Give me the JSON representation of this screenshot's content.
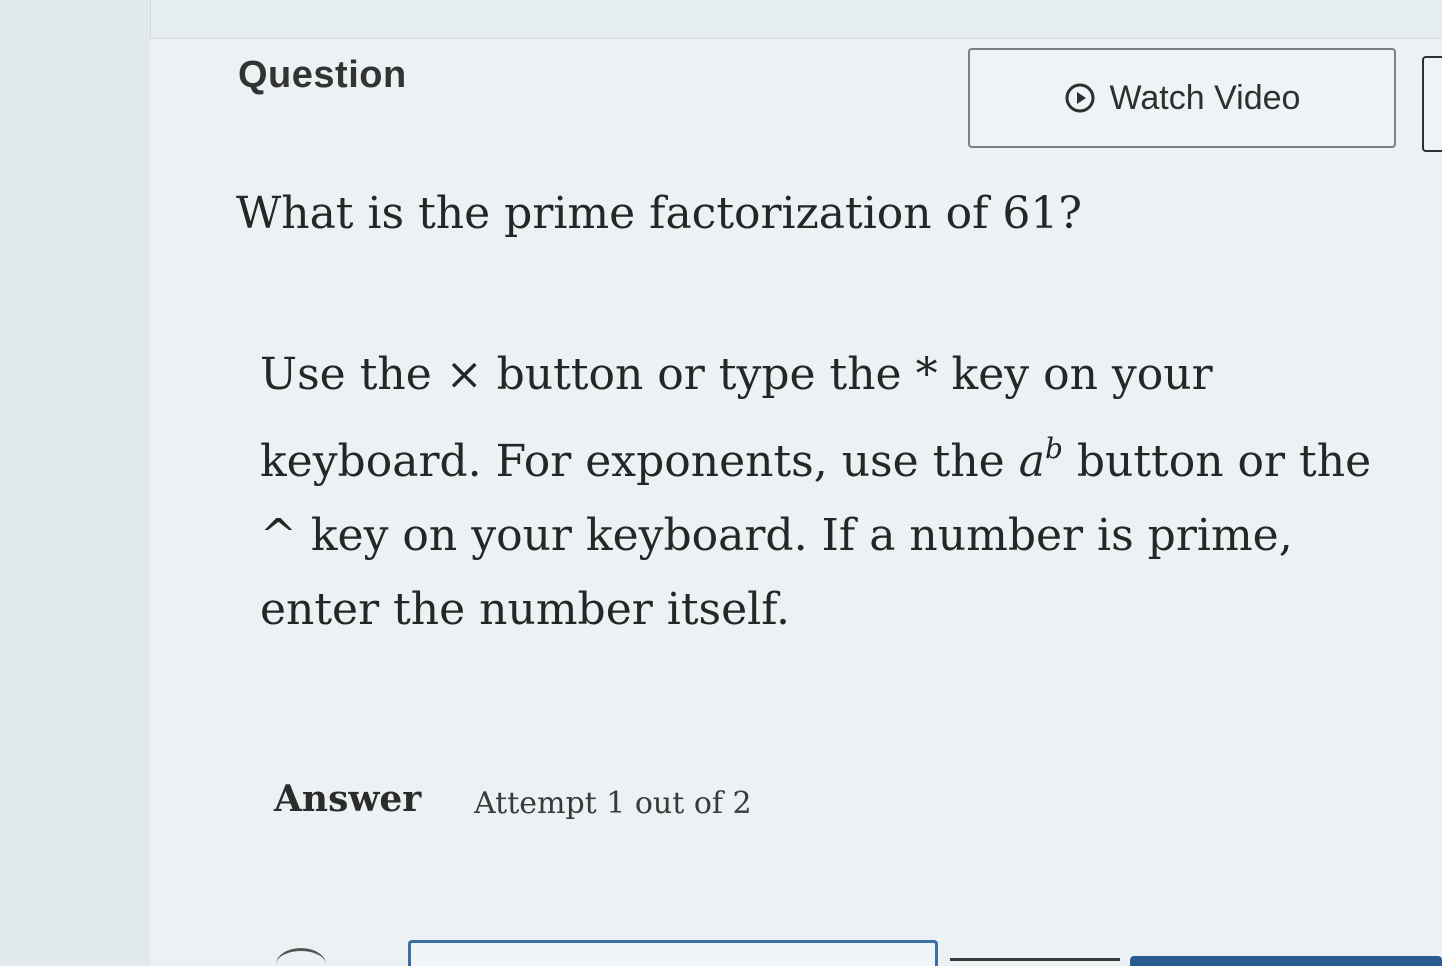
{
  "header": {
    "question_label": "Question",
    "watch_video_label": "Watch Video"
  },
  "question": {
    "text": "What is the prime factorization of 61?"
  },
  "instructions": {
    "part1": "Use the ",
    "times_symbol": "×",
    "part2": " button or type the ",
    "asterisk_symbol": "*",
    "part3": " key on your keyboard. For exponents, use the ",
    "ab_base": "a",
    "ab_exponent": "b",
    "part4": " button or the ",
    "caret_symbol": "^",
    "part5": " key on your keyboard. If a number is prime, enter the number itself."
  },
  "answer": {
    "label": "Answer",
    "attempt_text": "Attempt 1 out of 2"
  },
  "colors": {
    "accent": "#2a5d8f",
    "answer_box_border": "#3a6ea5"
  },
  "icons": {
    "watch_video": "play-circle-icon"
  }
}
